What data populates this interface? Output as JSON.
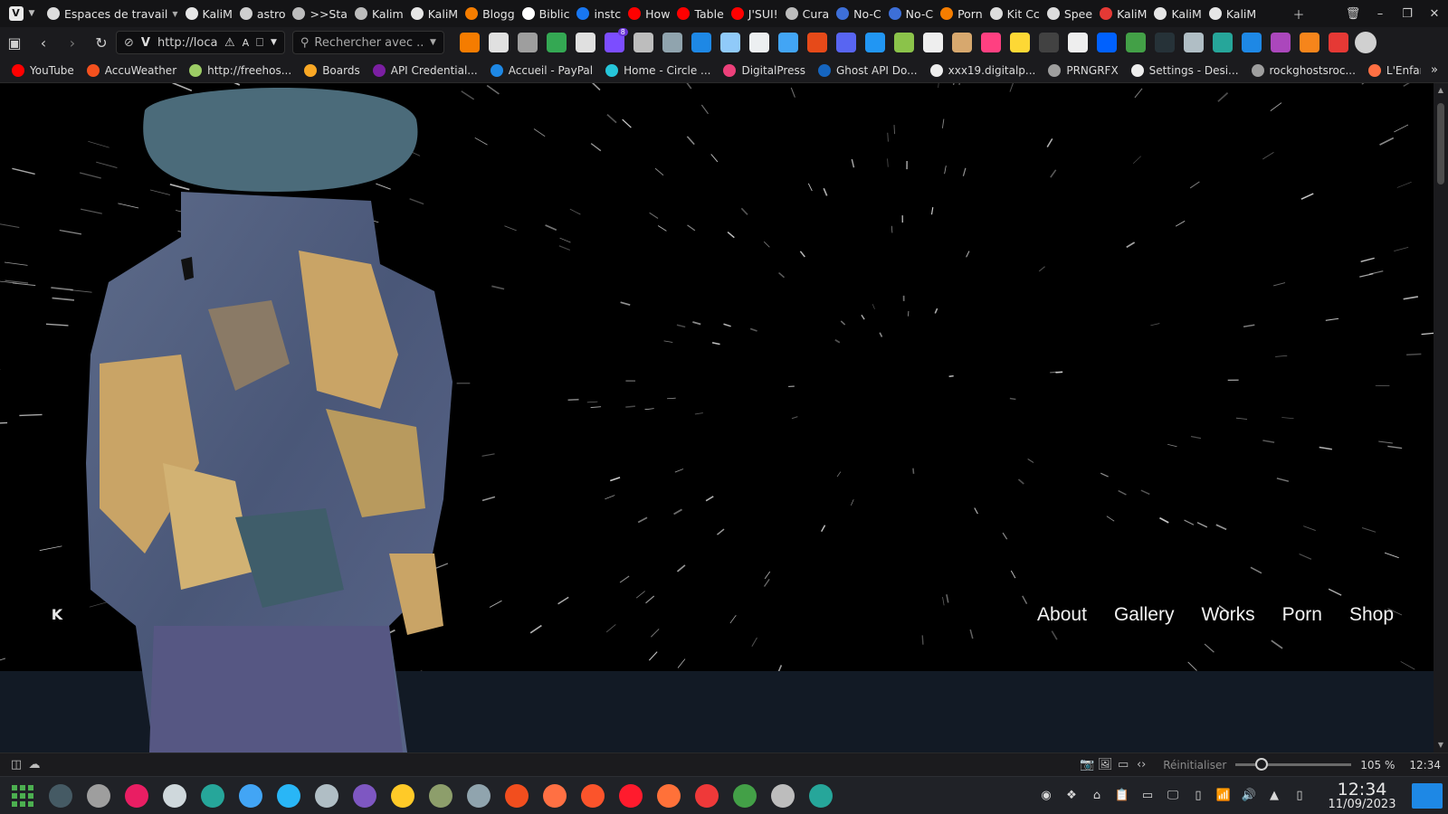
{
  "tabs": [
    {
      "label": "Espaces de travail",
      "icon": "layers-icon",
      "color": "#dddddd"
    },
    {
      "label": "KaliM",
      "icon": "github-icon",
      "color": "#e6e6e6"
    },
    {
      "label": "astro",
      "icon": "astro-icon",
      "color": "#cfcfcf"
    },
    {
      "label": ">>Sta",
      "icon": "at-icon",
      "color": "#bcbcbc"
    },
    {
      "label": "Kalim",
      "icon": "gear-icon",
      "color": "#bcbcbc"
    },
    {
      "label": "KaliM",
      "icon": "github-icon",
      "color": "#e6e6e6"
    },
    {
      "label": "Blogg",
      "icon": "blogger-icon",
      "color": "#f57d00"
    },
    {
      "label": "Biblic",
      "icon": "google-icon",
      "color": "#ffffff"
    },
    {
      "label": "instc",
      "icon": "facebook-icon",
      "color": "#1877f2"
    },
    {
      "label": "How",
      "icon": "youtube-icon",
      "color": "#ff0000"
    },
    {
      "label": "Table",
      "icon": "youtube-icon",
      "color": "#ff0000"
    },
    {
      "label": "J'SUI!",
      "icon": "youtube-icon",
      "color": "#ff0000"
    },
    {
      "label": "Cura",
      "icon": "bolt-icon",
      "color": "#bcbcbc"
    },
    {
      "label": "No-C",
      "icon": "s-icon",
      "color": "#3d6fd8"
    },
    {
      "label": "No-C",
      "icon": "s-icon",
      "color": "#3d6fd8"
    },
    {
      "label": "Porn",
      "icon": "blogger-icon",
      "color": "#f57d00"
    },
    {
      "label": "Kit Cc",
      "icon": "kit-icon",
      "color": "#dddddd"
    },
    {
      "label": "Spee",
      "icon": "grid-icon",
      "color": "#dddddd"
    },
    {
      "label": "KaliM",
      "icon": "info-icon",
      "color": "#e53935"
    },
    {
      "label": "KaliM",
      "icon": "github-icon",
      "color": "#e6e6e6"
    },
    {
      "label": "KaliM",
      "icon": "github-icon",
      "color": "#e6e6e6"
    }
  ],
  "address": {
    "url": "http://localh",
    "search_placeholder": "Rechercher avec ..."
  },
  "extensions": [
    {
      "name": "chess-icon",
      "color": "#f57c00"
    },
    {
      "name": "cloud-icon",
      "color": "#e0e0e0"
    },
    {
      "name": "tag-icon",
      "color": "#9e9e9e"
    },
    {
      "name": "drive-icon",
      "color": "#34a853"
    },
    {
      "name": "store-icon",
      "color": "#e0e0e0"
    },
    {
      "name": "puzzle-icon",
      "color": "#7c4dff",
      "badge": "8"
    },
    {
      "name": "window-icon",
      "color": "#bdbdbd"
    },
    {
      "name": "mouse-icon",
      "color": "#90a4ae"
    },
    {
      "name": "screenshot-icon",
      "color": "#1e88e5"
    },
    {
      "name": "feather-icon",
      "color": "#90caf9"
    },
    {
      "name": "compass-icon",
      "color": "#eceff1"
    },
    {
      "name": "wave-icon",
      "color": "#42a5f5"
    },
    {
      "name": "office-icon",
      "color": "#e64a19"
    },
    {
      "name": "discord-icon",
      "color": "#5865f2"
    },
    {
      "name": "grammar-icon",
      "color": "#2196f3"
    },
    {
      "name": "photo-icon",
      "color": "#8bc34a"
    },
    {
      "name": "matrix-icon",
      "color": "#eeeeee"
    },
    {
      "name": "cookie-icon",
      "color": "#d7a86e"
    },
    {
      "name": "pen-icon",
      "color": "#ff4081"
    },
    {
      "name": "note-icon",
      "color": "#fdd835"
    },
    {
      "name": "octocat-icon",
      "color": "#424242"
    },
    {
      "name": "cube-icon",
      "color": "#eeeeee"
    },
    {
      "name": "dropbox-icon",
      "color": "#0061fe"
    },
    {
      "name": "csv-icon",
      "color": "#43a047"
    },
    {
      "name": "blank-icon",
      "color": "#263238"
    },
    {
      "name": "people-icon",
      "color": "#b0bec5"
    },
    {
      "name": "export-icon",
      "color": "#26a69a"
    },
    {
      "name": "vscode-icon",
      "color": "#1e88e5"
    },
    {
      "name": "code-icon",
      "color": "#ab47bc"
    },
    {
      "name": "fox-icon",
      "color": "#f6851b"
    },
    {
      "name": "red-square-icon",
      "color": "#e53935"
    }
  ],
  "bookmarks": [
    {
      "label": "YouTube",
      "color": "#ff0000"
    },
    {
      "label": "AccuWeather",
      "color": "#f4511e"
    },
    {
      "label": "http://freehos...",
      "color": "#9ccc65"
    },
    {
      "label": "Boards",
      "color": "#f9a825"
    },
    {
      "label": "API Credential...",
      "color": "#7b1fa2"
    },
    {
      "label": "Accueil - PayPal",
      "color": "#1e88e5"
    },
    {
      "label": "Home - Circle ...",
      "color": "#26c6da"
    },
    {
      "label": "DigitalPress",
      "color": "#ec407a"
    },
    {
      "label": "Ghost API Do...",
      "color": "#1565c0"
    },
    {
      "label": "xxx19.digitalp...",
      "color": "#eeeeee"
    },
    {
      "label": "PRNGRFX",
      "color": "#9e9e9e"
    },
    {
      "label": "Settings - Desi...",
      "color": "#eeeeee"
    },
    {
      "label": "rockghostsroc...",
      "color": "#9e9e9e"
    },
    {
      "label": "L'Enfant du R...",
      "color": "#ff7043"
    }
  ],
  "site": {
    "logo_text": "K",
    "nav": [
      "About",
      "Gallery",
      "Works",
      "Porn",
      "Shop"
    ]
  },
  "status": {
    "reset_label": "Réinitialiser",
    "zoom": "105 %",
    "zoom_level": 105,
    "time": "12:34"
  },
  "taskbar": {
    "apps": [
      {
        "name": "terminal-icon",
        "color": "#455a64"
      },
      {
        "name": "files-icon",
        "color": "#9e9e9e"
      },
      {
        "name": "download-icon",
        "color": "#e91e63"
      },
      {
        "name": "stack-icon",
        "color": "#cfd8dc"
      },
      {
        "name": "camera-icon",
        "color": "#26a69a"
      },
      {
        "name": "eye-icon",
        "color": "#42a5f5"
      },
      {
        "name": "bird-icon",
        "color": "#29b6f6"
      },
      {
        "name": "ship-icon",
        "color": "#b0bec5"
      },
      {
        "name": "obsidian-icon",
        "color": "#7e57c2"
      },
      {
        "name": "palette-icon",
        "color": "#ffca28"
      },
      {
        "name": "tank-icon",
        "color": "#8d9e6b"
      },
      {
        "name": "settings-icon",
        "color": "#90a4ae"
      },
      {
        "name": "figma-icon",
        "color": "#f24e1e"
      },
      {
        "name": "ring-icon",
        "color": "#ff7043"
      },
      {
        "name": "brave-icon",
        "color": "#fb542b"
      },
      {
        "name": "opera-icon",
        "color": "#ff1b2d"
      },
      {
        "name": "firefox-icon",
        "color": "#ff7139"
      },
      {
        "name": "vivaldi-icon",
        "color": "#ef3939"
      },
      {
        "name": "notes-icon",
        "color": "#43a047"
      },
      {
        "name": "clipboard-icon",
        "color": "#bdbdbd"
      },
      {
        "name": "monitor-icon",
        "color": "#26a69a"
      }
    ],
    "clock_time": "12:34",
    "clock_date": "11/09/2023"
  }
}
